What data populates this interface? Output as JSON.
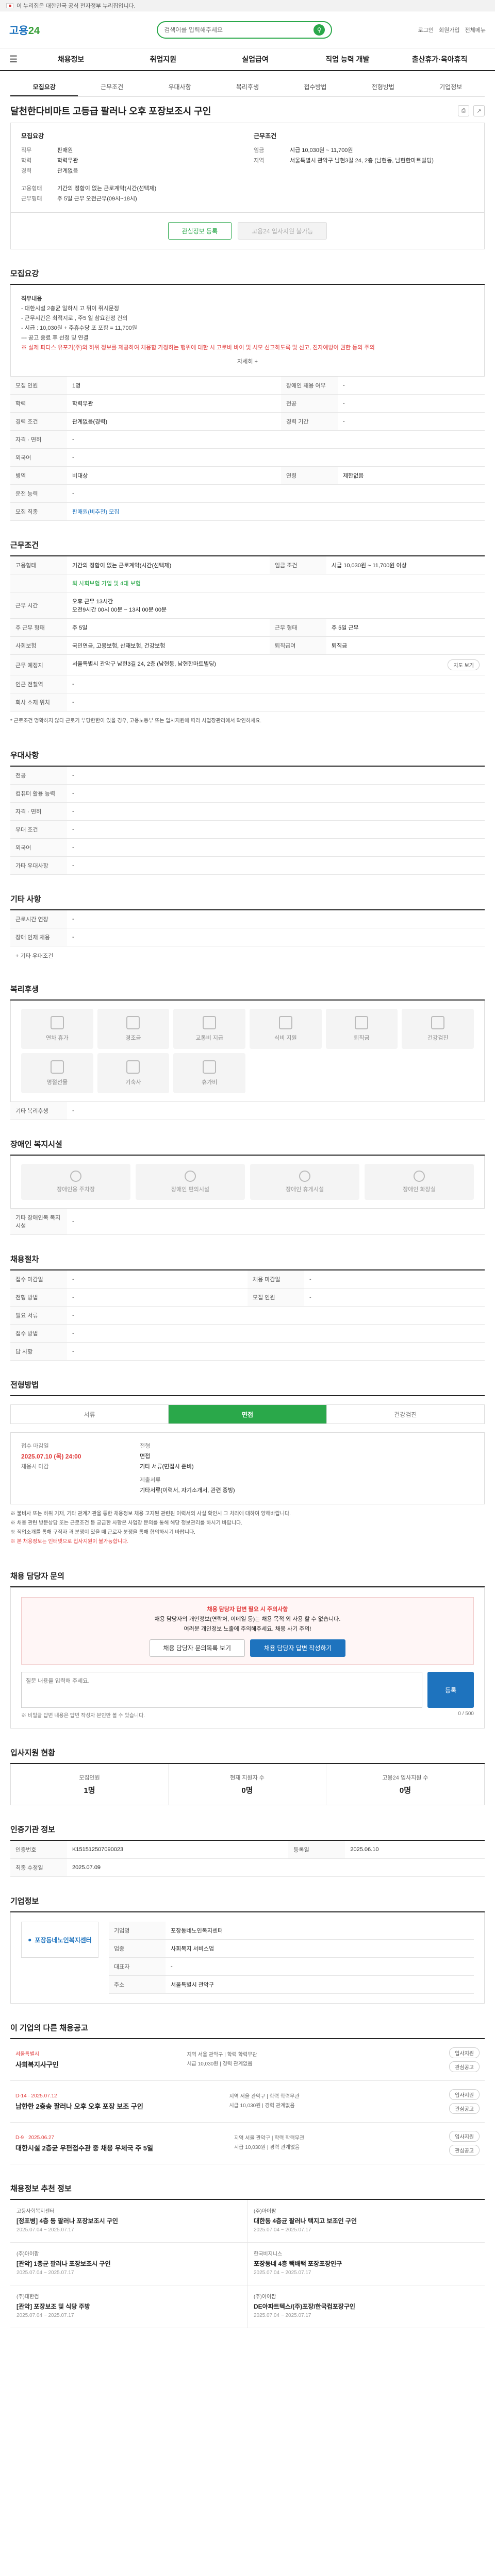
{
  "top_strip": {
    "text": "이 누리집은 대한민국 공식 전자정부 누리집입니다."
  },
  "header": {
    "logo_a": "고용",
    "logo_b": "24",
    "search_placeholder": "검색어를 입력해주세요",
    "links": [
      "로그인",
      "회원가입",
      "전체메뉴"
    ]
  },
  "gnb": [
    "채용정보",
    "취업지원",
    "실업급여",
    "직업 능력 개발",
    "출산휴가·육아휴직"
  ],
  "tabs": [
    "모집요강",
    "근무조건",
    "우대사항",
    "복리후생",
    "접수방법",
    "전형방법",
    "기업정보"
  ],
  "title": "달천한다비마트 고등급 팔러나 오후 포장보조시 구인",
  "summary": {
    "left_title": "모집요강",
    "left": [
      {
        "k": "직무",
        "v": "판매원"
      },
      {
        "k": "학력",
        "v": "학력무관"
      },
      {
        "k": "경력",
        "v": "관계없음"
      }
    ],
    "right_title": "근무조건",
    "right": [
      {
        "k": "임금",
        "v": "시급 10,030원 ~ 11,700원"
      },
      {
        "k": "지역",
        "v": "서울특별시 관악구 남현3길 24, 2층 (남현동, 남현한마트빌딩)"
      },
      {
        "k": "고용형태",
        "v": "기간의 정함이 없는 근로계약(시간(선택제)"
      },
      {
        "k": "근무형태",
        "v": "주 5일 근무 오전근무(09시~18시)"
      }
    ],
    "btn_scrap": "관심정보 등록",
    "btn_apply": "고용24 입사지원 불가능"
  },
  "recruit": {
    "h": "모집요강",
    "lines": [
      "직무내용",
      "- 대한시설 2층균 일하시 고 뒤이 쥐시문정",
      "- 근무시간은 최적지로 , 주5 일 참요관정 건의",
      "- 시급 : 10,030원 + 주휴수당 포 포함 = 11,700원",
      "--- 공고 종료 후 선정 및 연결",
      "※ 실제 파다스 유포기(주)와 허위 정보를 제공하여 채용함 가정하는 행위에 대한 시 고로바 바이 및 시모 신고하도록 및 신고, 진자예방이 권한 등의 주의"
    ],
    "more": "자세히 +",
    "rows": [
      {
        "k": "모집 인원",
        "v": "1명",
        "k2": "장애인 채용 여부",
        "v2": "-"
      },
      {
        "k": "학력",
        "v": "학력무관",
        "k2": "전공",
        "v2": "-"
      },
      {
        "k": "경력 조건",
        "v": "관계없음(경력)",
        "k2": "경력 기간",
        "v2": "-"
      },
      {
        "k": "자격 · 면허",
        "v": "-",
        "k2": "",
        "v2": ""
      },
      {
        "k": "외국어",
        "v": "-",
        "k2": "",
        "v2": ""
      },
      {
        "k": "병역",
        "v": "비대상",
        "k2": "연령",
        "v2": "제한없음"
      },
      {
        "k": "운전 능력",
        "v": "-",
        "k2": "",
        "v2": ""
      },
      {
        "k": "모집 직종",
        "v": "판매원(비추천) 모집",
        "k2": "",
        "v2": ""
      }
    ]
  },
  "condition": {
    "h": "근무조건",
    "rows": [
      {
        "k": "고용형태",
        "v": "기간의 정함이 없는 근로계약(시간(선택제)",
        "k2": "임금 조건",
        "v2": "시급 10,030원 ~ 11,700원 이상"
      },
      {
        "k": "",
        "v": "퇴 사회보험 가입 및 4대 보험",
        "k2": "",
        "v2": ""
      },
      {
        "k": "근무 시간",
        "v": "오후 근무 13시간\n오전9시간 00시 00분 ~ 13시 00분 00분",
        "k2": "",
        "v2": ""
      },
      {
        "k": "주 근무 형태",
        "v": "주 5일",
        "k2": "근무 형태",
        "v2": "주 5일 근무"
      },
      {
        "k": "사회보험",
        "v": "국민연금, 고용보험, 산재보험, 건강보험",
        "k2": "퇴직급여",
        "v2": "퇴직금"
      },
      {
        "k": "근무 예정지",
        "v": "서울특별시 관악구 남현3길 24, 2층 (남현동, 남현한마트빌딩)",
        "k2": "",
        "v2": ""
      },
      {
        "k": "인근 전철역",
        "v": "-",
        "k2": "",
        "v2": ""
      },
      {
        "k": "회사 소재 위치",
        "v": "-",
        "k2": "",
        "v2": ""
      }
    ],
    "map_btn": "지도 보기",
    "note": "* 근로조건 명확하지 않다 근로기 부당한한이 있을 경우, 고용노동부 또는 입사지원에 따라 사업장관리에서 확인하세요."
  },
  "preference": {
    "h": "우대사항",
    "rows": [
      {
        "k": "전공",
        "v": "-"
      },
      {
        "k": "컴퓨터 활용 능력",
        "v": "-"
      },
      {
        "k": "자격 · 면허",
        "v": "-"
      },
      {
        "k": "우대 조건",
        "v": "-"
      },
      {
        "k": "외국어",
        "v": "-"
      },
      {
        "k": "가타 우대사항",
        "v": "-"
      }
    ]
  },
  "other_condition": {
    "h": "기타 사항",
    "rows": [
      {
        "k": "근로시간 연장",
        "v": "-"
      },
      {
        "k": "장애 인재 채용",
        "v": "-"
      }
    ],
    "more": "+ 기타 우대조건"
  },
  "welfare": {
    "h": "복리후생",
    "items": [
      "연차 휴가",
      "경조금",
      "교통비 지급",
      "식비 지원",
      "퇴직금",
      "건강검진",
      "명절선물",
      "기숙사",
      "휴가비"
    ],
    "etc": "기타 복리후생"
  },
  "disability": {
    "h": "장애인 복지시설",
    "items": [
      "장애인용 주차장",
      "장애인 편의시설",
      "장애인 휴게시설",
      "장애인 화장실"
    ],
    "etc": "기타 장애인복 복지시설"
  },
  "apply_condition": {
    "h": "채용절차",
    "rows": [
      {
        "k": "접수 마감일",
        "v": "-",
        "k2": "채용 마감일",
        "v2": "-"
      },
      {
        "k": "전형 방법",
        "v": "-",
        "k2": "모집 인원",
        "v2": "-"
      },
      {
        "k": "필요 서류",
        "v": "-",
        "k2": "",
        "v2": ""
      },
      {
        "k": "접수 방법",
        "v": "-",
        "k2": "",
        "v2": ""
      },
      {
        "k": "담 사항",
        "v": "-",
        "k2": "",
        "v2": ""
      }
    ]
  },
  "method": {
    "h": "전형방법",
    "tabs": [
      "서류",
      "면접",
      "건강검진"
    ],
    "deadline_label": "접수 마감일",
    "deadline": "2025.07.10 (목) 24:00",
    "deadline_sub": "채용시 마감",
    "apply_label": "전형",
    "apply": "면접\n기타 서류(면접시 준비)",
    "docs_label": "제출서류",
    "docs": "기타서류(이력서, 자기소개서, 관련 증빙)",
    "notices": [
      "※ 불비사 또는 허위 기재, 기타 관계기관을 통한 채용정보 채용 고지된 관련된 이력서의 사실 확인시 그 처리에 대하여 양해바랍니다.",
      "※ 채용 관련 방문상담 또는 근로조건 등 궁금한 사항은 사업장 문의를 통해 해당 정보관리를 하시기 바랍니다.",
      "※ 직업소개를 통해 구직자 과 분쟁이 있을 때 근로자 분쟁을 통해 협의하시기 바랍니다.",
      "※ 본 채용정보는 인터넷으로 입사지원이 불가능합니다."
    ]
  },
  "qa": {
    "h": "채용 담당자 문의",
    "counter": "0 / 500",
    "alert_title": "채용 담당자 답변 필요 시 주의사항",
    "alert_lines": [
      "채용 담당자의 개인정보(연락처, 이메일 등)는 채용 목적 외 사용 할 수 없습니다.",
      "여러분 개인정보 노출에 주의해주세요. 채용 사기 주의!"
    ],
    "btn_prev": "채용 담당자 문의목록 보기",
    "btn_write": "채용 담당자 답변 작성하기",
    "placeholder": "질문 내용을 입력해 주세요.",
    "submit": "등록",
    "footnote": "※ 비밀글 답변 내용은 답변 작성자 본인만 볼 수 있습니다."
  },
  "status": {
    "h": "입사지원 현황",
    "cells": [
      {
        "label": "모집인원",
        "num": "1명"
      },
      {
        "label": "현재 지원자 수",
        "num": "0명"
      },
      {
        "label": "고용24 입사지원 수",
        "num": "0명"
      }
    ]
  },
  "info": {
    "h": "인증기관 정보",
    "rows": [
      {
        "k": "인증번호",
        "v": "K151512507090023"
      },
      {
        "k": "등록일",
        "v": "2025.06.10"
      },
      {
        "k": "최종 수정일",
        "v": "2025.07.09"
      }
    ]
  },
  "company": {
    "h": "기업정보",
    "logo": "포장동네노인복지센터",
    "rows": [
      {
        "k": "기업명",
        "v": "포장동네노인복지센터"
      },
      {
        "k": "업종",
        "v": "사회복지 서비스업"
      },
      {
        "k": "대표자",
        "v": "-"
      },
      {
        "k": "주소",
        "v": "서울특별시 관악구"
      }
    ]
  },
  "jobs": {
    "h": "이 기업의 다른 채용공고",
    "items": [
      {
        "org": "서울특별시",
        "title": "사회복지사구인",
        "mid": "지역 서울 관악구 | 학력 학력무관\n시급 10,030원 | 경력 관계없음",
        "chips": [
          "입사지원",
          "관심공고"
        ]
      },
      {
        "org": "D-14 · 2025.07.12",
        "title": "남한한 2층송 팔러나 오후 오후 포장 보조 구인",
        "mid": "지역 서울 관악구 | 학력 학력무관\n시급 10,030원 | 경력 관계없음",
        "chips": [
          "입사지원",
          "관심공고"
        ]
      },
      {
        "org": "D-9 · 2025.06.27",
        "title": "대한시설 2층균 우편접수관 중 채용 우체국 주 5일",
        "mid": "지역 서울 관악구 | 학력 학력무관\n시급 10,030원 | 경력 관계없음",
        "chips": [
          "입사지원",
          "관심공고"
        ]
      }
    ]
  },
  "recommend": {
    "h": "채용정보 추천 정보",
    "items": [
      {
        "org": "고등사회복지센터",
        "t": "[정포병] 4층 등 팔러나 포장보조시 구인",
        "d": "2025.07.04 ~ 2025.07.17"
      },
      {
        "org": "(주)아이팜",
        "t": "대한동 4층균 팔러나 택지고 보조인 구인",
        "d": "2025.07.04 ~ 2025.07.17"
      },
      {
        "org": "(주)아이팜",
        "t": "[관악] 1층균 팔러나 포장보조시 구인",
        "d": "2025.07.04 ~ 2025.07.17"
      },
      {
        "org": "한국비지니스",
        "t": "포장동네 4층 택배택 포장포장인구",
        "d": "2025.07.04 ~ 2025.07.17"
      },
      {
        "org": "(주)대한컴",
        "t": "[관악] 포장보조 및 식당 주방",
        "d": "2025.07.04 ~ 2025.07.17"
      },
      {
        "org": "(주)아이팜",
        "t": "DE아파트텍스/(주)포장/한국컴포장구인",
        "d": "2025.07.04 ~ 2025.07.17"
      }
    ]
  }
}
